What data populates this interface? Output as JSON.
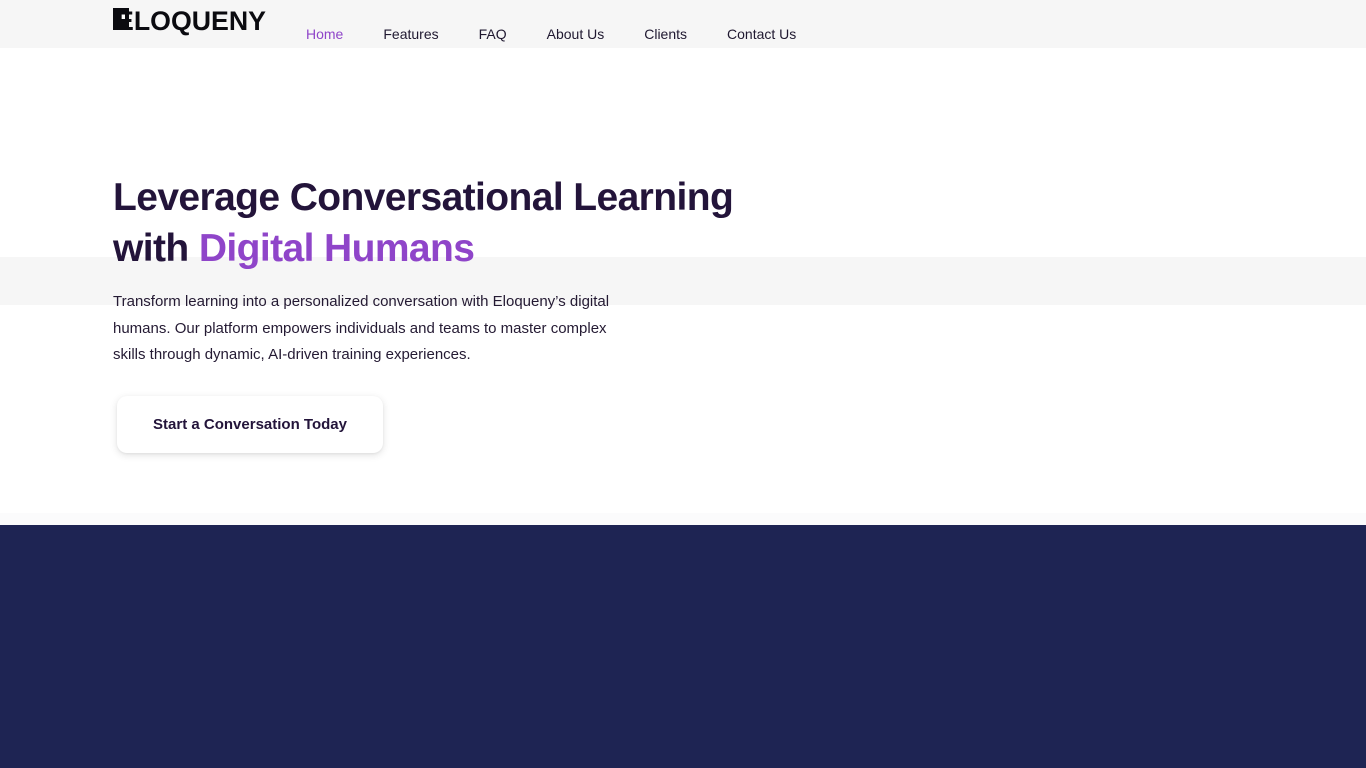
{
  "brand": {
    "logo_text": "ELOQUENY"
  },
  "nav": {
    "items": [
      {
        "label": "Home",
        "active": true
      },
      {
        "label": "Features",
        "active": false
      },
      {
        "label": "FAQ",
        "active": false
      },
      {
        "label": "About Us",
        "active": false
      },
      {
        "label": "Clients",
        "active": false
      },
      {
        "label": "Contact Us",
        "active": false
      }
    ]
  },
  "hero": {
    "title_line1": "Leverage Conversational Learning",
    "title_prefix": "with",
    "title_accent": "Digital Humans",
    "description": "Transform learning into a personalized conversation with Eloqueny’s digital humans. Our platform empowers individuals and teams to master complex skills through dynamic, AI-driven training experiences.",
    "cta_label": "Start a Conversation Today"
  },
  "colors": {
    "accent": "#8f45c9",
    "heading": "#23143a",
    "dark_section": "#1e2453"
  }
}
